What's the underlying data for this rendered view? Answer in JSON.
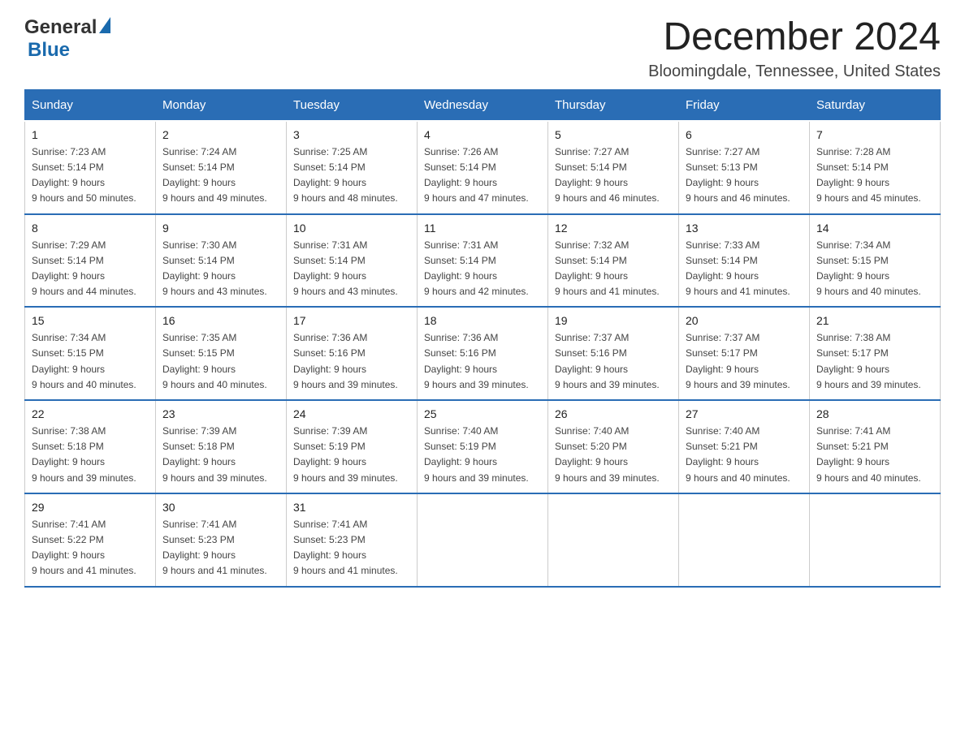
{
  "logo": {
    "text_general": "General",
    "text_blue": "Blue",
    "alt": "GeneralBlue logo"
  },
  "header": {
    "month_year": "December 2024",
    "location": "Bloomingdale, Tennessee, United States"
  },
  "weekdays": [
    "Sunday",
    "Monday",
    "Tuesday",
    "Wednesday",
    "Thursday",
    "Friday",
    "Saturday"
  ],
  "weeks": [
    [
      {
        "day": "1",
        "sunrise": "7:23 AM",
        "sunset": "5:14 PM",
        "daylight": "9 hours and 50 minutes."
      },
      {
        "day": "2",
        "sunrise": "7:24 AM",
        "sunset": "5:14 PM",
        "daylight": "9 hours and 49 minutes."
      },
      {
        "day": "3",
        "sunrise": "7:25 AM",
        "sunset": "5:14 PM",
        "daylight": "9 hours and 48 minutes."
      },
      {
        "day": "4",
        "sunrise": "7:26 AM",
        "sunset": "5:14 PM",
        "daylight": "9 hours and 47 minutes."
      },
      {
        "day": "5",
        "sunrise": "7:27 AM",
        "sunset": "5:14 PM",
        "daylight": "9 hours and 46 minutes."
      },
      {
        "day": "6",
        "sunrise": "7:27 AM",
        "sunset": "5:13 PM",
        "daylight": "9 hours and 46 minutes."
      },
      {
        "day": "7",
        "sunrise": "7:28 AM",
        "sunset": "5:14 PM",
        "daylight": "9 hours and 45 minutes."
      }
    ],
    [
      {
        "day": "8",
        "sunrise": "7:29 AM",
        "sunset": "5:14 PM",
        "daylight": "9 hours and 44 minutes."
      },
      {
        "day": "9",
        "sunrise": "7:30 AM",
        "sunset": "5:14 PM",
        "daylight": "9 hours and 43 minutes."
      },
      {
        "day": "10",
        "sunrise": "7:31 AM",
        "sunset": "5:14 PM",
        "daylight": "9 hours and 43 minutes."
      },
      {
        "day": "11",
        "sunrise": "7:31 AM",
        "sunset": "5:14 PM",
        "daylight": "9 hours and 42 minutes."
      },
      {
        "day": "12",
        "sunrise": "7:32 AM",
        "sunset": "5:14 PM",
        "daylight": "9 hours and 41 minutes."
      },
      {
        "day": "13",
        "sunrise": "7:33 AM",
        "sunset": "5:14 PM",
        "daylight": "9 hours and 41 minutes."
      },
      {
        "day": "14",
        "sunrise": "7:34 AM",
        "sunset": "5:15 PM",
        "daylight": "9 hours and 40 minutes."
      }
    ],
    [
      {
        "day": "15",
        "sunrise": "7:34 AM",
        "sunset": "5:15 PM",
        "daylight": "9 hours and 40 minutes."
      },
      {
        "day": "16",
        "sunrise": "7:35 AM",
        "sunset": "5:15 PM",
        "daylight": "9 hours and 40 minutes."
      },
      {
        "day": "17",
        "sunrise": "7:36 AM",
        "sunset": "5:16 PM",
        "daylight": "9 hours and 39 minutes."
      },
      {
        "day": "18",
        "sunrise": "7:36 AM",
        "sunset": "5:16 PM",
        "daylight": "9 hours and 39 minutes."
      },
      {
        "day": "19",
        "sunrise": "7:37 AM",
        "sunset": "5:16 PM",
        "daylight": "9 hours and 39 minutes."
      },
      {
        "day": "20",
        "sunrise": "7:37 AM",
        "sunset": "5:17 PM",
        "daylight": "9 hours and 39 minutes."
      },
      {
        "day": "21",
        "sunrise": "7:38 AM",
        "sunset": "5:17 PM",
        "daylight": "9 hours and 39 minutes."
      }
    ],
    [
      {
        "day": "22",
        "sunrise": "7:38 AM",
        "sunset": "5:18 PM",
        "daylight": "9 hours and 39 minutes."
      },
      {
        "day": "23",
        "sunrise": "7:39 AM",
        "sunset": "5:18 PM",
        "daylight": "9 hours and 39 minutes."
      },
      {
        "day": "24",
        "sunrise": "7:39 AM",
        "sunset": "5:19 PM",
        "daylight": "9 hours and 39 minutes."
      },
      {
        "day": "25",
        "sunrise": "7:40 AM",
        "sunset": "5:19 PM",
        "daylight": "9 hours and 39 minutes."
      },
      {
        "day": "26",
        "sunrise": "7:40 AM",
        "sunset": "5:20 PM",
        "daylight": "9 hours and 39 minutes."
      },
      {
        "day": "27",
        "sunrise": "7:40 AM",
        "sunset": "5:21 PM",
        "daylight": "9 hours and 40 minutes."
      },
      {
        "day": "28",
        "sunrise": "7:41 AM",
        "sunset": "5:21 PM",
        "daylight": "9 hours and 40 minutes."
      }
    ],
    [
      {
        "day": "29",
        "sunrise": "7:41 AM",
        "sunset": "5:22 PM",
        "daylight": "9 hours and 41 minutes."
      },
      {
        "day": "30",
        "sunrise": "7:41 AM",
        "sunset": "5:23 PM",
        "daylight": "9 hours and 41 minutes."
      },
      {
        "day": "31",
        "sunrise": "7:41 AM",
        "sunset": "5:23 PM",
        "daylight": "9 hours and 41 minutes."
      },
      null,
      null,
      null,
      null
    ]
  ],
  "labels": {
    "sunrise": "Sunrise:",
    "sunset": "Sunset:",
    "daylight": "Daylight:"
  }
}
